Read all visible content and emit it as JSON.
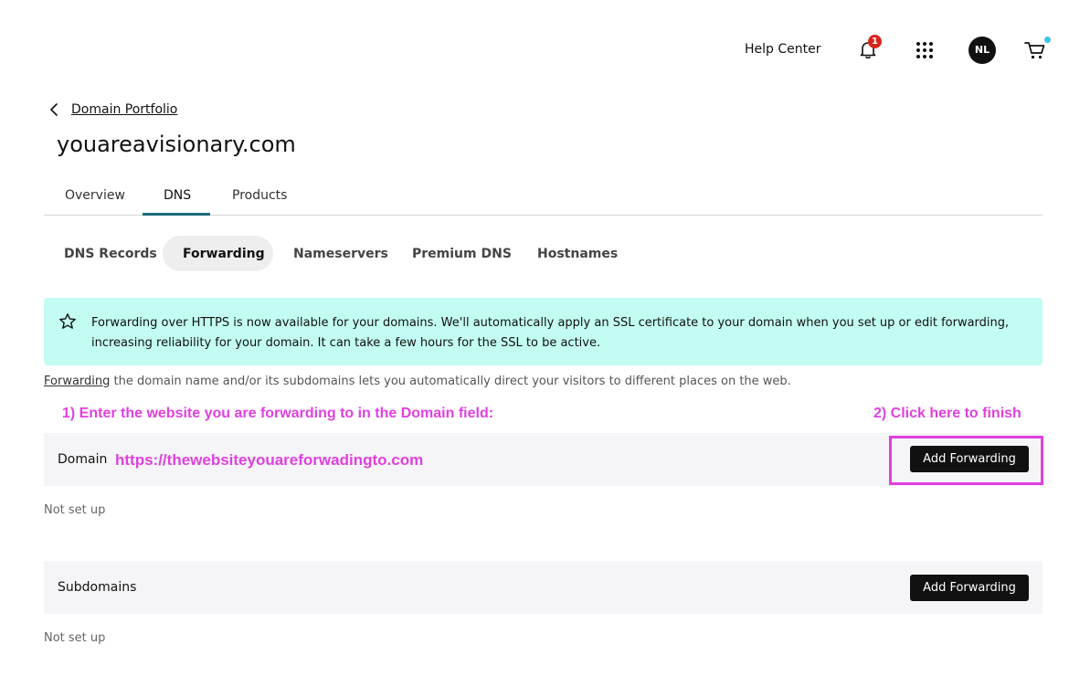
{
  "header": {
    "help_label": "Help Center",
    "notification_count": "1",
    "avatar_initials": "NL",
    "icons": [
      "bell-icon",
      "apps-grid-icon",
      "cart-icon"
    ]
  },
  "breadcrumb": {
    "label": "Domain Portfolio"
  },
  "page_title": "youareavisionary.com",
  "tabs": [
    {
      "label": "Overview",
      "active": false
    },
    {
      "label": "DNS",
      "active": true
    },
    {
      "label": "Products",
      "active": false
    }
  ],
  "subtabs": [
    {
      "label": "DNS Records",
      "active": false
    },
    {
      "label": "Forwarding",
      "active": true
    },
    {
      "label": "Nameservers",
      "active": false
    },
    {
      "label": "Premium DNS",
      "active": false
    },
    {
      "label": "Hostnames",
      "active": false
    }
  ],
  "banner": {
    "text": "Forwarding over HTTPS is now available for your domains. We'll automatically apply an SSL certificate to your domain when you set up or edit forwarding, increasing reliability for your domain. It can take a few hours for the SSL to be active."
  },
  "description": {
    "link": "Forwarding",
    "text": " the domain name and/or its subdomains lets you automatically direct your visitors to different places on the web."
  },
  "annotations": {
    "step1": "1) Enter the website you are forwarding to in the Domain field:",
    "step2": "2) Click here to finish",
    "url": "https://thewebsiteyouareforwadingto.com"
  },
  "domain_section": {
    "label": "Domain",
    "button": "Add Forwarding",
    "status": "Not set up"
  },
  "subdomain_section": {
    "label": "Subdomains",
    "button": "Add Forwarding",
    "status": "Not set up"
  },
  "colors": {
    "banner_bg": "#c3fcf2",
    "annotation": "#e040e0",
    "tab_underline": "#1c6d7c"
  }
}
